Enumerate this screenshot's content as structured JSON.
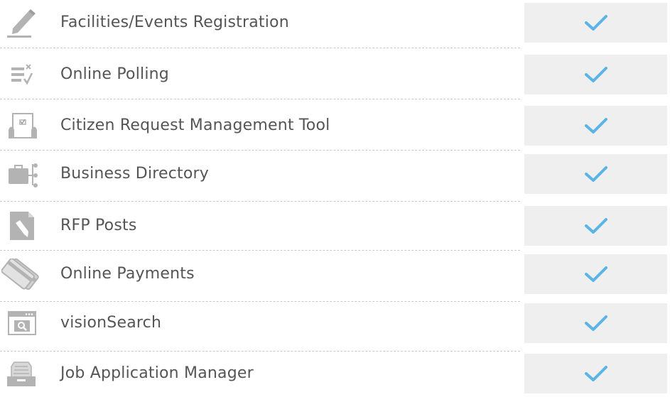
{
  "features": [
    {
      "label": "Facilities/Events Registration",
      "icon": "pencil-icon",
      "included": true
    },
    {
      "label": "Online Polling",
      "icon": "poll-list-icon",
      "included": true
    },
    {
      "label": "Citizen Request Management Tool",
      "icon": "request-form-icon",
      "included": true
    },
    {
      "label": "Business Directory",
      "icon": "briefcase-directory-icon",
      "included": true
    },
    {
      "label": "RFP Posts",
      "icon": "document-pencil-icon",
      "included": true
    },
    {
      "label": "Online Payments",
      "icon": "credit-card-icon",
      "included": true
    },
    {
      "label": "visionSearch",
      "icon": "search-window-icon",
      "included": true
    },
    {
      "label": "Job Application Manager",
      "icon": "file-tray-icon",
      "included": true
    }
  ],
  "colors": {
    "label_text": "#555555",
    "icon_gray": "#b3b3b3",
    "check_blue": "#5ab4e5",
    "check_cell_bg": "#efefef"
  }
}
